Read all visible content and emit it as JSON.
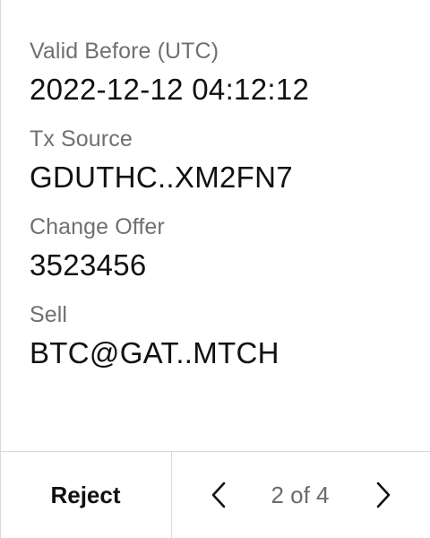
{
  "fields": [
    {
      "label": "Valid Before (UTC)",
      "value": "2022-12-12 04:12:12"
    },
    {
      "label": "Tx Source",
      "value": "GDUTHC..XM2FN7"
    },
    {
      "label": "Change Offer",
      "value": "3523456"
    },
    {
      "label": "Sell",
      "value": "BTC@GAT..MTCH"
    }
  ],
  "footer": {
    "reject_label": "Reject",
    "page_indicator": "2 of 4",
    "prev_icon": "chevron-left-icon",
    "next_icon": "chevron-right-icon"
  }
}
